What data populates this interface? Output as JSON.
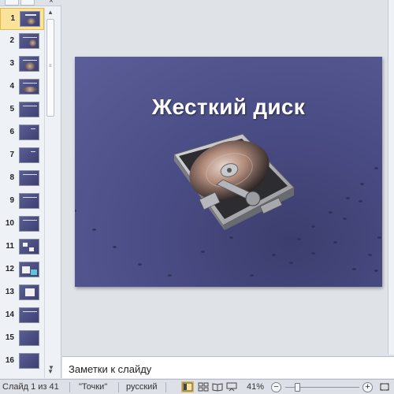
{
  "thumbnails": {
    "selected": "1",
    "items": [
      {
        "number": "1"
      },
      {
        "number": "2"
      },
      {
        "number": "3"
      },
      {
        "number": "4"
      },
      {
        "number": "5"
      },
      {
        "number": "6"
      },
      {
        "number": "7"
      },
      {
        "number": "8"
      },
      {
        "number": "9"
      },
      {
        "number": "10"
      },
      {
        "number": "11"
      },
      {
        "number": "12"
      },
      {
        "number": "13"
      },
      {
        "number": "14"
      },
      {
        "number": "15"
      },
      {
        "number": "16"
      }
    ]
  },
  "slide": {
    "title": "Жесткий диск",
    "image": "hard-disk-drive-picture"
  },
  "notes": {
    "placeholder": "Заметки к слайду"
  },
  "status_bar": {
    "slide_counter": "Слайд 1 из 41",
    "theme": "\"Точки\"",
    "language": "русский",
    "zoom_level": "41%",
    "zoom_fraction": 0.41
  },
  "icons": {
    "close": "close-icon",
    "normal_view": "normal-view-icon",
    "slide_sorter": "slide-sorter-icon",
    "reading_view": "reading-view-icon",
    "slideshow": "slideshow-icon",
    "zoom_out": "zoom-out-icon",
    "zoom_in": "zoom-in-icon",
    "fit": "fit-to-window-icon"
  },
  "colors": {
    "selection": "#fbe39a",
    "slide_background": "#4a4c85"
  }
}
